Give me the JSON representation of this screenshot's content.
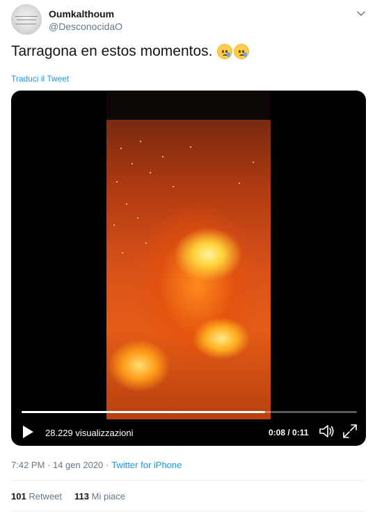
{
  "author": {
    "display_name": "Oumkalthoum",
    "handle": "@DesconocidaO"
  },
  "tweet": {
    "text": "Tarragona en estos momentos.",
    "emoji": [
      "crying-face",
      "crying-face"
    ],
    "translate_link": "Traduci il Tweet"
  },
  "video": {
    "views": "28.229 visualizzazioni",
    "time": "0:08 / 0:11",
    "progress": 0.727
  },
  "meta": {
    "timestamp": "7:42 PM · 14 gen 2020 ·",
    "source": "Twitter for iPhone"
  },
  "stats": {
    "retweets_count": "101",
    "retweets_label": "Retweet",
    "likes_count": "113",
    "likes_label": "Mi piace"
  },
  "colors": {
    "link": "#1b95e0",
    "secondary_text": "#657786",
    "primary_text": "#14171a"
  }
}
